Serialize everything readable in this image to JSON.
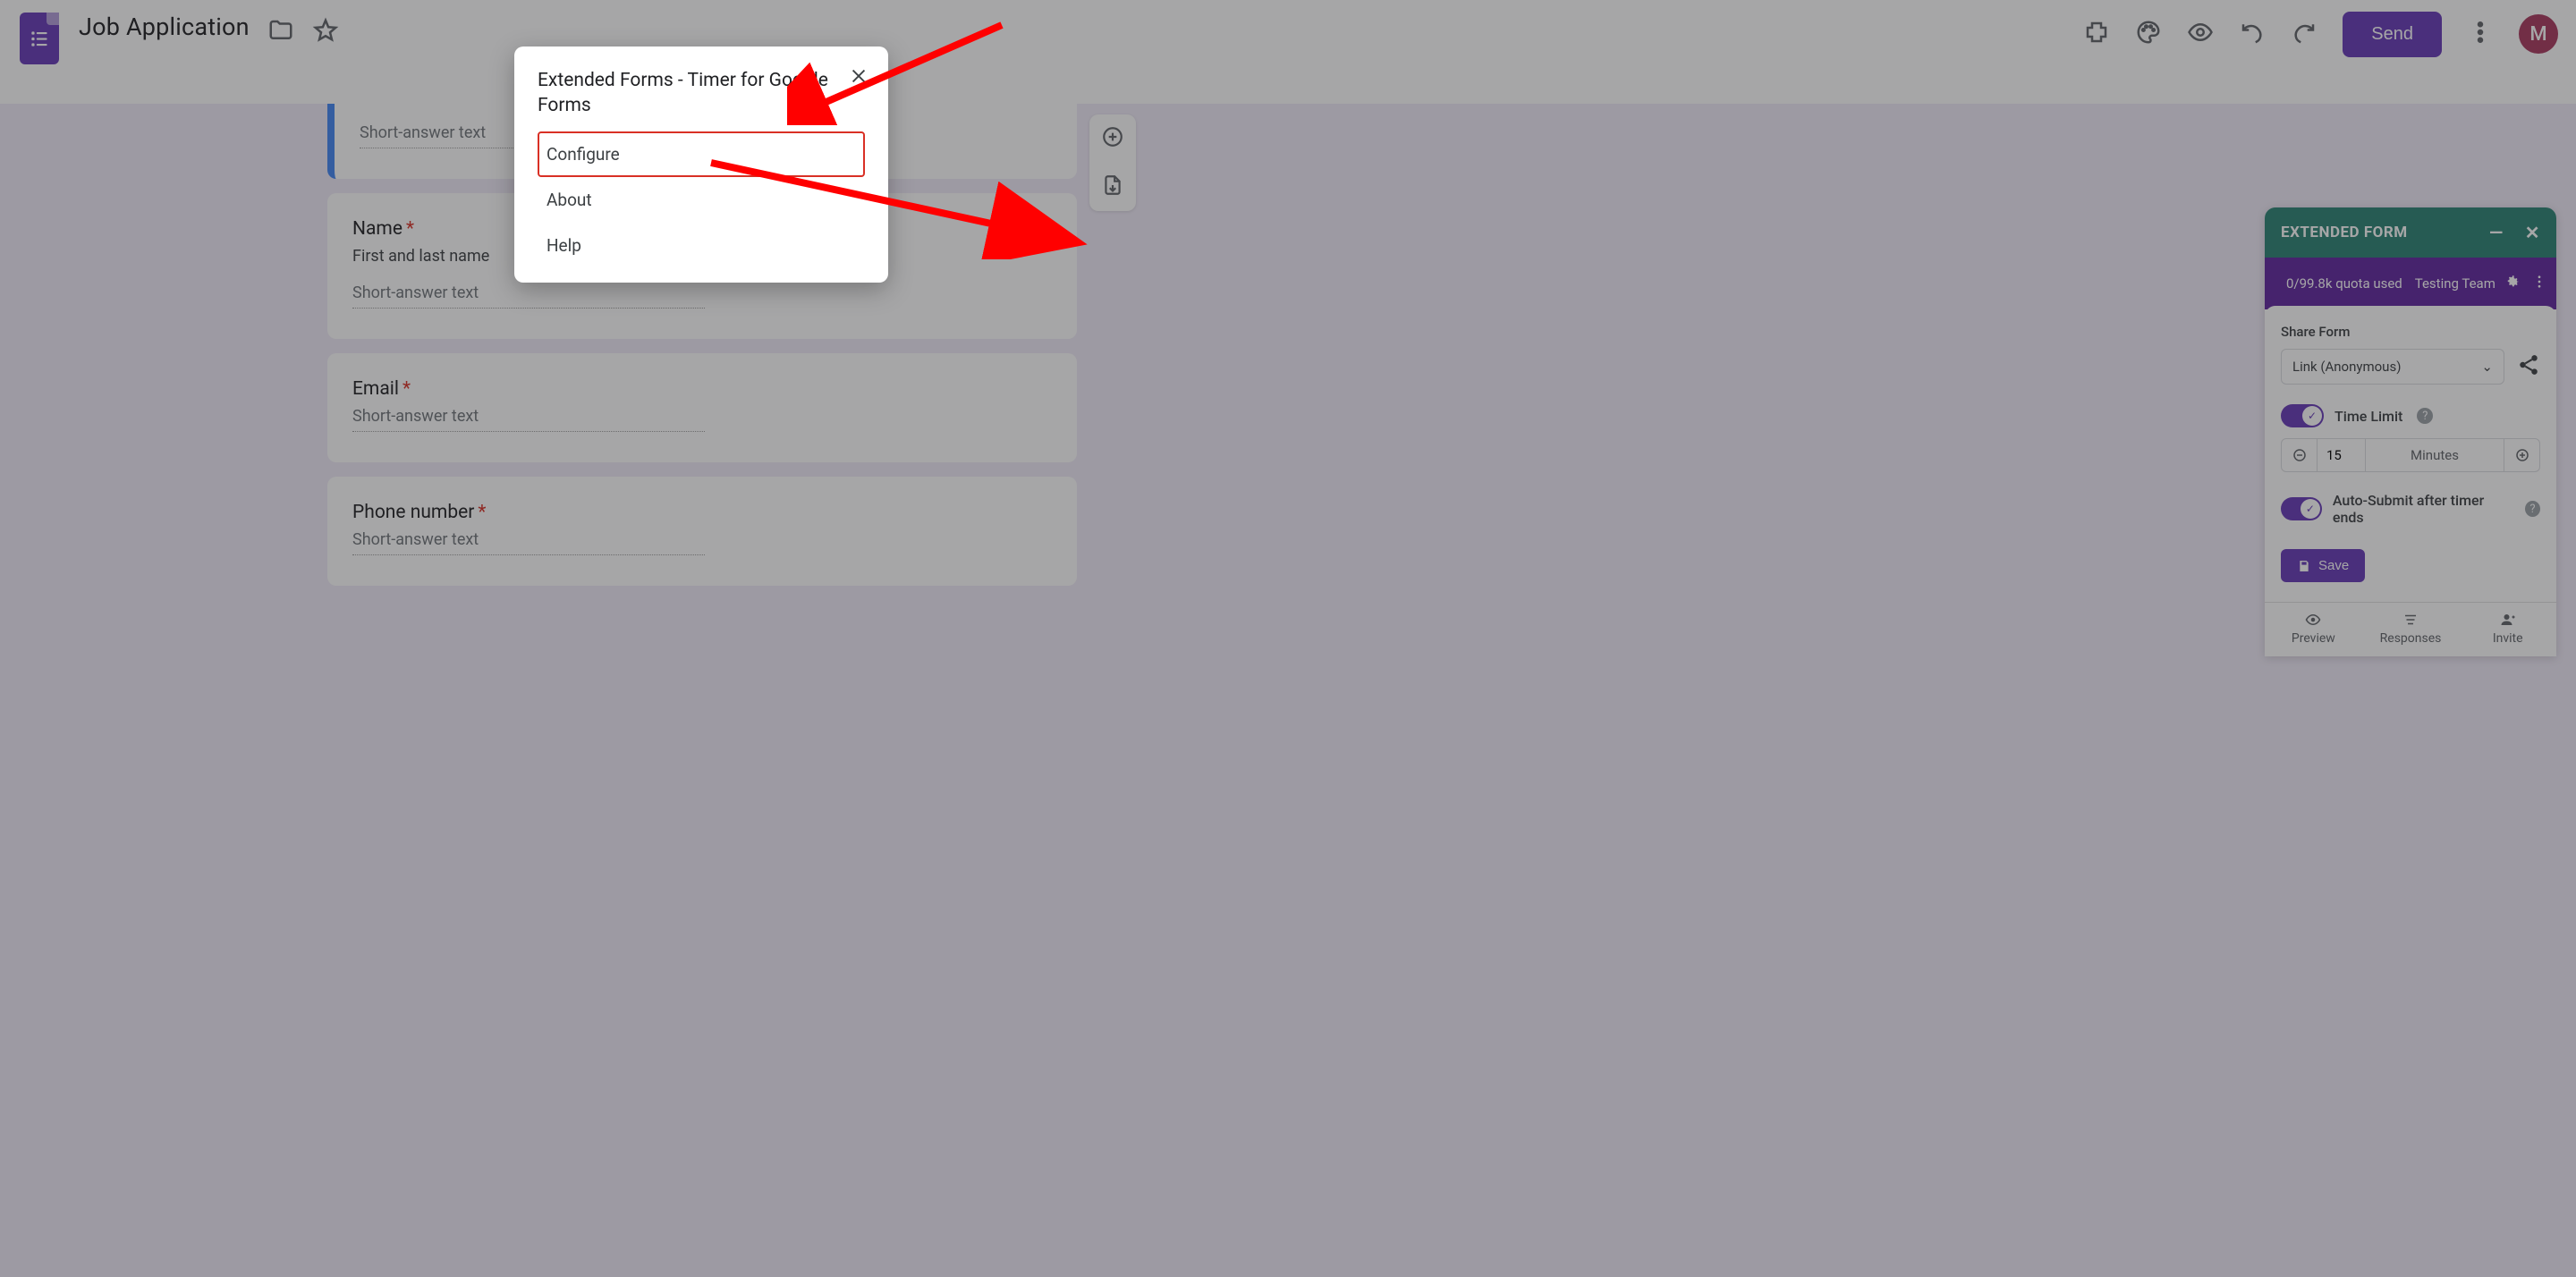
{
  "header": {
    "form_title": "Job Application",
    "send_label": "Send",
    "avatar_initial": "M"
  },
  "form": {
    "short_answer_placeholder": "Short-answer text",
    "questions": [
      {
        "label": "Name",
        "required": true,
        "desc": "First and last name"
      },
      {
        "label": "Email",
        "required": true,
        "desc": ""
      },
      {
        "label": "Phone number",
        "required": true,
        "desc": ""
      }
    ]
  },
  "modal": {
    "title": "Extended Forms - Timer for Google Forms",
    "items": {
      "configure": "Configure",
      "about": "About",
      "help": "Help"
    }
  },
  "ext_panel": {
    "header": "EXTENDED FORM",
    "quota": "0/99.8k quota used",
    "team": "Testing Team",
    "share_label": "Share Form",
    "share_option": "Link (Anonymous)",
    "time_limit_label": "Time Limit",
    "time_value": "15",
    "time_unit": "Minutes",
    "auto_submit_label": "Auto-Submit after timer ends",
    "save_label": "Save",
    "footer": {
      "preview": "Preview",
      "responses": "Responses",
      "invite": "Invite"
    }
  }
}
